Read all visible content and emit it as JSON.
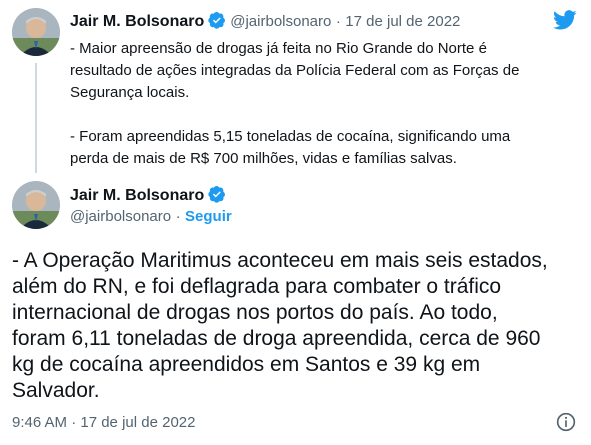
{
  "reply": {
    "author_name": "Jair M. Bolsonaro",
    "handle": "@jairbolsonaro",
    "separator": "·",
    "date": "17 de jul de 2022",
    "lines": [
      "- Maior apreensão de drogas já feita no Rio Grande do Norte é",
      "resultado de ações integradas da Polícia Federal com as Forças de",
      "Segurança locais.",
      "",
      "- Foram apreendidas 5,15 toneladas de cocaína, significando uma",
      "perda de mais de R$ 700 milhões, vidas e famílias salvas."
    ]
  },
  "main": {
    "author_name": "Jair M. Bolsonaro",
    "handle": "@jairbolsonaro",
    "separator": "·",
    "follow_label": "Seguir",
    "lines": [
      "- A Operação Maritimus aconteceu em mais seis estados,",
      "além do RN, e foi deflagrada para combater o tráfico",
      "internacional de drogas nos portos do país. Ao todo,",
      "foram 6,11 toneladas de droga apreendida, cerca de 960",
      "kg de cocaína apreendidos em Santos e 39 kg em",
      "Salvador."
    ],
    "timestamp": "9:46 AM · 17 de jul de 2022"
  },
  "colors": {
    "twitter_blue": "#1d9bf0",
    "verified": "#1d9bf0",
    "muted": "#536471"
  },
  "icons": [
    "twitter-bird-icon",
    "verified-badge-icon",
    "info-icon"
  ]
}
